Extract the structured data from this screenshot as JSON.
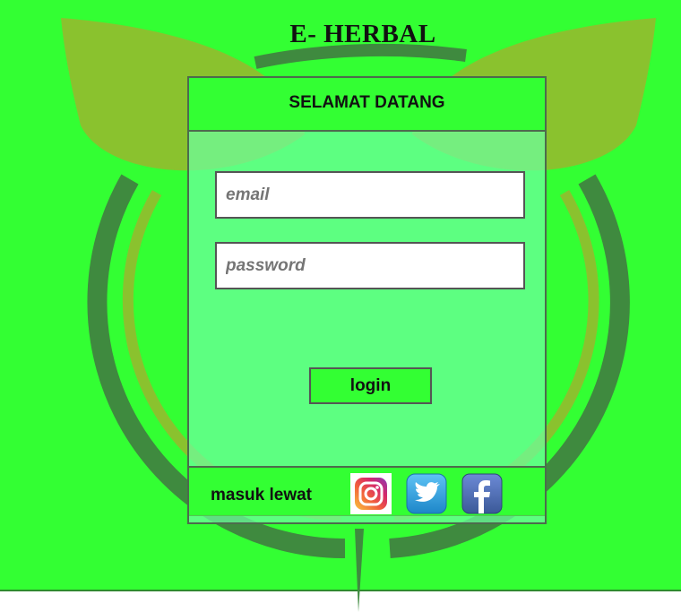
{
  "app": {
    "title": "E- HERBAL"
  },
  "login_card": {
    "header": "SELAMAT DATANG",
    "email_placeholder": "email",
    "password_placeholder": "password",
    "login_label": "login",
    "social_label": "masuk lewat",
    "social_icons": [
      "instagram-icon",
      "twitter-icon",
      "facebook-icon"
    ]
  },
  "colors": {
    "background": "#33ff33",
    "card": "#66ff99",
    "border": "#4d6b4d",
    "logo_ring": "#3f8a3f",
    "logo_leaf": "#8ac22e"
  }
}
